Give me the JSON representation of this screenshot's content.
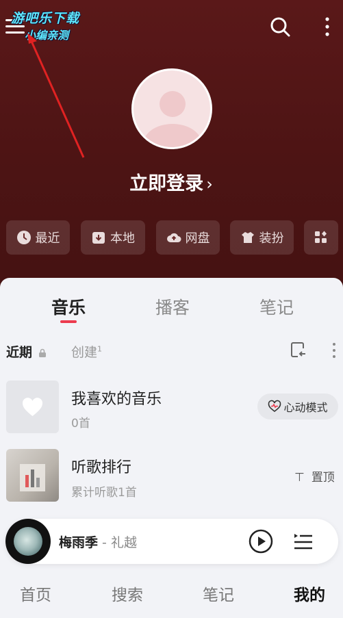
{
  "watermark": {
    "line1": "游吧乐下载",
    "line2": "小编亲测"
  },
  "header": {
    "login_label": "立即登录",
    "login_chevron": "›"
  },
  "quick_actions": [
    {
      "label": "最近",
      "icon": "clock-icon"
    },
    {
      "label": "本地",
      "icon": "download-box-icon"
    },
    {
      "label": "网盘",
      "icon": "cloud-upload-icon"
    },
    {
      "label": "装扮",
      "icon": "shirt-icon"
    },
    {
      "label": "",
      "icon": "grid-icon"
    }
  ],
  "tabs": [
    {
      "label": "音乐",
      "active": true
    },
    {
      "label": "播客",
      "active": false
    },
    {
      "label": "笔记",
      "active": false
    }
  ],
  "subtabs": {
    "recent": "近期",
    "created": "创建",
    "created_count": "1"
  },
  "playlists": [
    {
      "title": "我喜欢的音乐",
      "subtitle": "0首",
      "action": "心动模式"
    },
    {
      "title": "听歌排行",
      "subtitle": "累计听歌1首",
      "action": "置顶"
    }
  ],
  "player": {
    "title": "梅雨季",
    "separator": " - ",
    "artist": "礼越"
  },
  "bottom_nav": [
    {
      "label": "首页",
      "active": false
    },
    {
      "label": "搜索",
      "active": false
    },
    {
      "label": "笔记",
      "active": false
    },
    {
      "label": "我的",
      "active": true
    }
  ],
  "colors": {
    "accent": "#ec3b4e",
    "header_bg": "#4d1414",
    "panel_bg": "#f2f3f7"
  }
}
